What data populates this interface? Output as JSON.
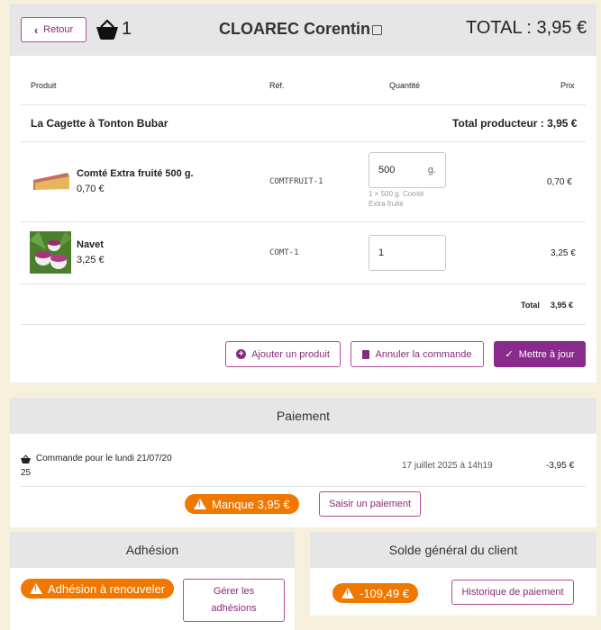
{
  "header": {
    "back_label": "Retour",
    "basket_count": "1",
    "client_name": "CLOAREC Corentin",
    "total_label": "TOTAL : 3,95 €"
  },
  "table": {
    "col_product": "Produit",
    "col_ref": "Réf.",
    "col_qty": "Quantité",
    "col_price": "Prix",
    "producer_name": "La Cagette à Tonton Bubar",
    "producer_total": "Total producteur : 3,95 €",
    "rows": [
      {
        "name": "Comté Extra fruité 500 g.",
        "unit_price": "0,70 €",
        "ref": "COMTFRUIT-1",
        "qty": "500",
        "unit": "g.",
        "hint_line1": "1 × 500 g. Comté",
        "hint_line2": "Extra fruité",
        "price": "0,70 €"
      },
      {
        "name": "Navet",
        "unit_price": "3,25 €",
        "ref": "COMT-1",
        "qty": "1",
        "price": "3,25 €"
      }
    ],
    "total_label": "Total",
    "total_value": "3,95 €"
  },
  "actions": {
    "add_product": "Ajouter un produit",
    "cancel_order": "Annuler la commande",
    "update": "Mettre à jour"
  },
  "payment": {
    "title": "Paiement",
    "order_line1": "Commande pour le lundi 21/07/20",
    "order_line2": "25",
    "date": "17 juillet 2025 à 14h19",
    "amount": "-3,95 €",
    "missing_badge": "Manque 3,95 €",
    "add_payment": "Saisir un paiement"
  },
  "membership": {
    "title": "Adhésion",
    "badge": "Adhésion à renouveler",
    "manage_line1": "Gérer les",
    "manage_line2": "adhésions"
  },
  "balance": {
    "title": "Solde général du client",
    "badge": "-109,49 €",
    "history": "Historique de paiement"
  },
  "colors": {
    "accent": "#8a2a8c",
    "warning": "#f07800",
    "background": "#f6efdc"
  }
}
